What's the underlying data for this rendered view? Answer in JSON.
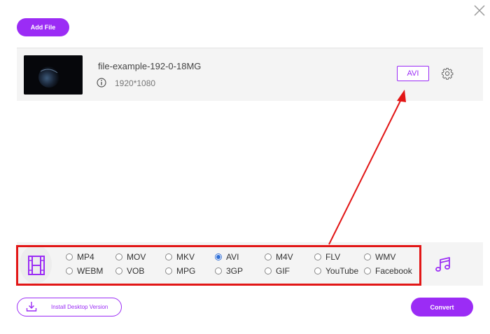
{
  "toolbar": {
    "add_file_label": "Add File",
    "close_icon": "close-icon"
  },
  "file": {
    "name": "file-example-192-0-18MG",
    "resolution": "1920*1080",
    "format_label": "AVI",
    "icons": [
      "info-icon",
      "gear-icon"
    ]
  },
  "formats": {
    "row1": [
      {
        "label": "MP4",
        "checked": false
      },
      {
        "label": "MOV",
        "checked": false
      },
      {
        "label": "MKV",
        "checked": false
      },
      {
        "label": "AVI",
        "checked": true
      },
      {
        "label": "M4V",
        "checked": false
      },
      {
        "label": "FLV",
        "checked": false
      },
      {
        "label": "WMV",
        "checked": false
      }
    ],
    "row2": [
      {
        "label": "WEBM",
        "checked": false
      },
      {
        "label": "VOB",
        "checked": false
      },
      {
        "label": "MPG",
        "checked": false
      },
      {
        "label": "3GP",
        "checked": false
      },
      {
        "label": "GIF",
        "checked": false
      },
      {
        "label": "YouTube",
        "checked": false
      },
      {
        "label": "Facebook",
        "checked": false
      }
    ],
    "selected": "AVI",
    "tabs": [
      "video-icon",
      "music-icon"
    ]
  },
  "footer": {
    "install_label": "Install Desktop Version",
    "convert_label": "Convert"
  },
  "colors": {
    "accent": "#9b2cf5",
    "highlight": "#e21616",
    "radio_checked": "#2f6fd6"
  }
}
